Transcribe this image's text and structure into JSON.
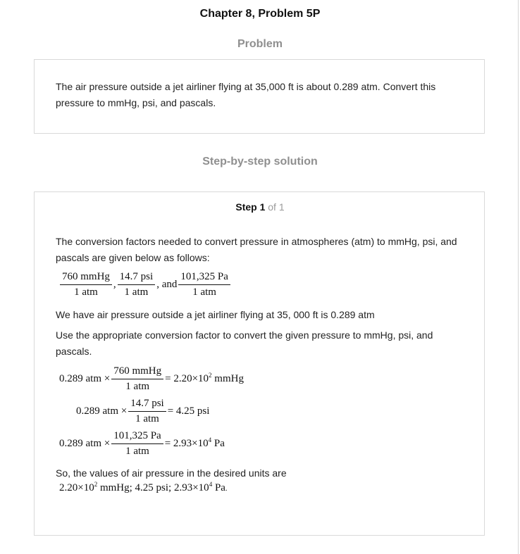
{
  "header": {
    "chapter_title": "Chapter 8, Problem 5P",
    "problem_heading": "Problem",
    "solution_heading": "Step-by-step solution"
  },
  "problem": {
    "text": "The air pressure outside a jet airliner flying at 35,000 ft is about 0.289 atm. Convert this pressure to mmHg, psi, and pascals."
  },
  "step": {
    "label": "Step 1",
    "count": "of 1",
    "intro": "The conversion factors needed to convert pressure in atmospheres (atm) to mmHg, psi, and pascals are given below as follows:",
    "factors": {
      "f1_num": "760 mmHg",
      "f1_den": "1 atm",
      "sep1": ",",
      "f2_num": "14.7 psi",
      "f2_den": "1 atm",
      "sep2": ", and",
      "f3_num": "101,325 Pa",
      "f3_den": "1 atm"
    },
    "given": "We have air pressure outside a jet airliner flying at 35, 000 ft is 0.289 atm",
    "use_text": "Use the appropriate conversion factor to convert the given pressure to mmHg, psi, and pascals.",
    "eq1": {
      "lhs": "0.289 atm ×",
      "num": "760 mmHg",
      "den": "1 atm",
      "rhs_pre": "= 2.20×10",
      "exp": "2",
      "rhs_unit": " mmHg"
    },
    "eq2": {
      "lhs": "0.289 atm ×",
      "num": "14.7 psi",
      "den": "1 atm",
      "rhs": "= 4.25 psi"
    },
    "eq3": {
      "lhs": "0.289 atm ×",
      "num": "101,325 Pa",
      "den": "1 atm",
      "rhs_pre": "= 2.93×10",
      "exp": "4",
      "rhs_unit": " Pa"
    },
    "conclusion": "So, the values of air pressure in the desired units are",
    "final": {
      "part1": "2.20×10",
      "exp1": "2",
      "part2": " mmHg; 4.25 psi; 2.93×10",
      "exp2": "4",
      "part3": " Pa",
      "end": "."
    }
  }
}
